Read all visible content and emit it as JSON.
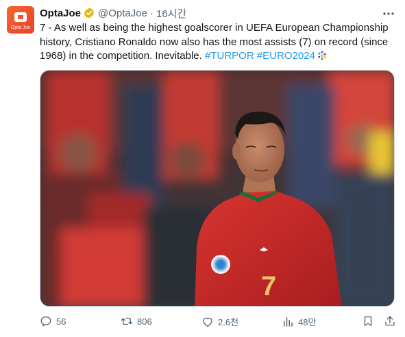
{
  "tweet": {
    "author_name": "OptaJoe",
    "handle": "@OptaJoe",
    "separator": "·",
    "time": "16시간",
    "avatar_text": "Opta Joe",
    "text_before": "7 - As well as being the highest goalscorer in UEFA European Championship history, Cristiano Ronaldo now also has the most assists (7) on record (since 1968) in the competition. Inevitable. ",
    "hashtags": [
      "#TURPOR",
      "#EURO2024"
    ],
    "jersey_number": "7"
  },
  "actions": {
    "replies": "56",
    "reposts": "806",
    "likes": "2.6천",
    "views": "48만"
  },
  "colors": {
    "brand_orange": "#f2552c",
    "link": "#1d9bf0",
    "muted": "#536471",
    "verified_gold": "#e2b719"
  }
}
